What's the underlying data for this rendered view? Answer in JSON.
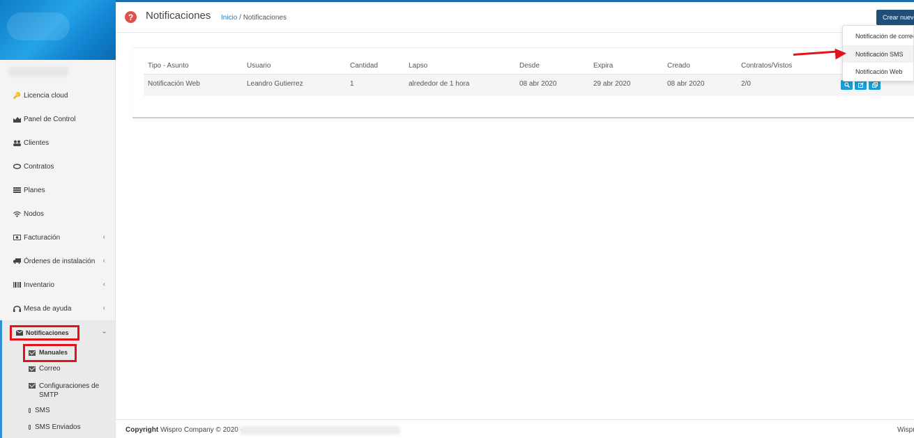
{
  "header": {
    "title": "Notificaciones",
    "breadcrumb_home": "Inicio",
    "breadcrumb_sep": " / ",
    "breadcrumb_current": "Notificaciones",
    "create_button": "Crear nuevo"
  },
  "dropdown": {
    "items": [
      "Notificación de correo",
      "Notificación SMS",
      "Notificación Web"
    ]
  },
  "sidebar": {
    "items": [
      {
        "label": "Licencia cloud",
        "icon": "cloud-key-icon"
      },
      {
        "label": "Panel de Control",
        "icon": "area-chart-icon"
      },
      {
        "label": "Clientes",
        "icon": "users-icon"
      },
      {
        "label": "Contratos",
        "icon": "handshake-icon"
      },
      {
        "label": "Planes",
        "icon": "server-icon"
      },
      {
        "label": "Nodos",
        "icon": "wifi-icon"
      },
      {
        "label": "Facturación",
        "icon": "money-icon"
      },
      {
        "label": "Órdenes de instalación",
        "icon": "truck-icon"
      },
      {
        "label": "Inventario",
        "icon": "barcode-icon"
      },
      {
        "label": "Mesa de ayuda",
        "icon": "headset-icon"
      },
      {
        "label": "Notificaciones",
        "icon": "envelope-icon"
      }
    ],
    "submenu": {
      "manuales": "Manuales",
      "correo": "Correo",
      "smtp": "Configuraciones de SMTP",
      "sms": "SMS",
      "sms_enviados": "SMS Enviados"
    }
  },
  "table": {
    "headers": [
      "Tipo - Asunto",
      "Usuario",
      "Cantidad",
      "Lapso",
      "Desde",
      "Expira",
      "Creado",
      "Contratos/Vistos"
    ],
    "rows": [
      [
        "Notificación Web",
        "Leandro Gutierrez",
        "1",
        "alrededor de 1 hora",
        "08 abr 2020",
        "29 abr 2020",
        "08 abr 2020",
        "2/0"
      ]
    ]
  },
  "footer": {
    "copyright_label": "Copyright",
    "copyright_text": " Wispro Company © 2020 -",
    "right_text": "Wispro"
  },
  "colors": {
    "accent": "#1b6fa8",
    "highlight": "#e2121a",
    "create_button": "#1f4e79",
    "action_button": "#1e9ad6"
  }
}
